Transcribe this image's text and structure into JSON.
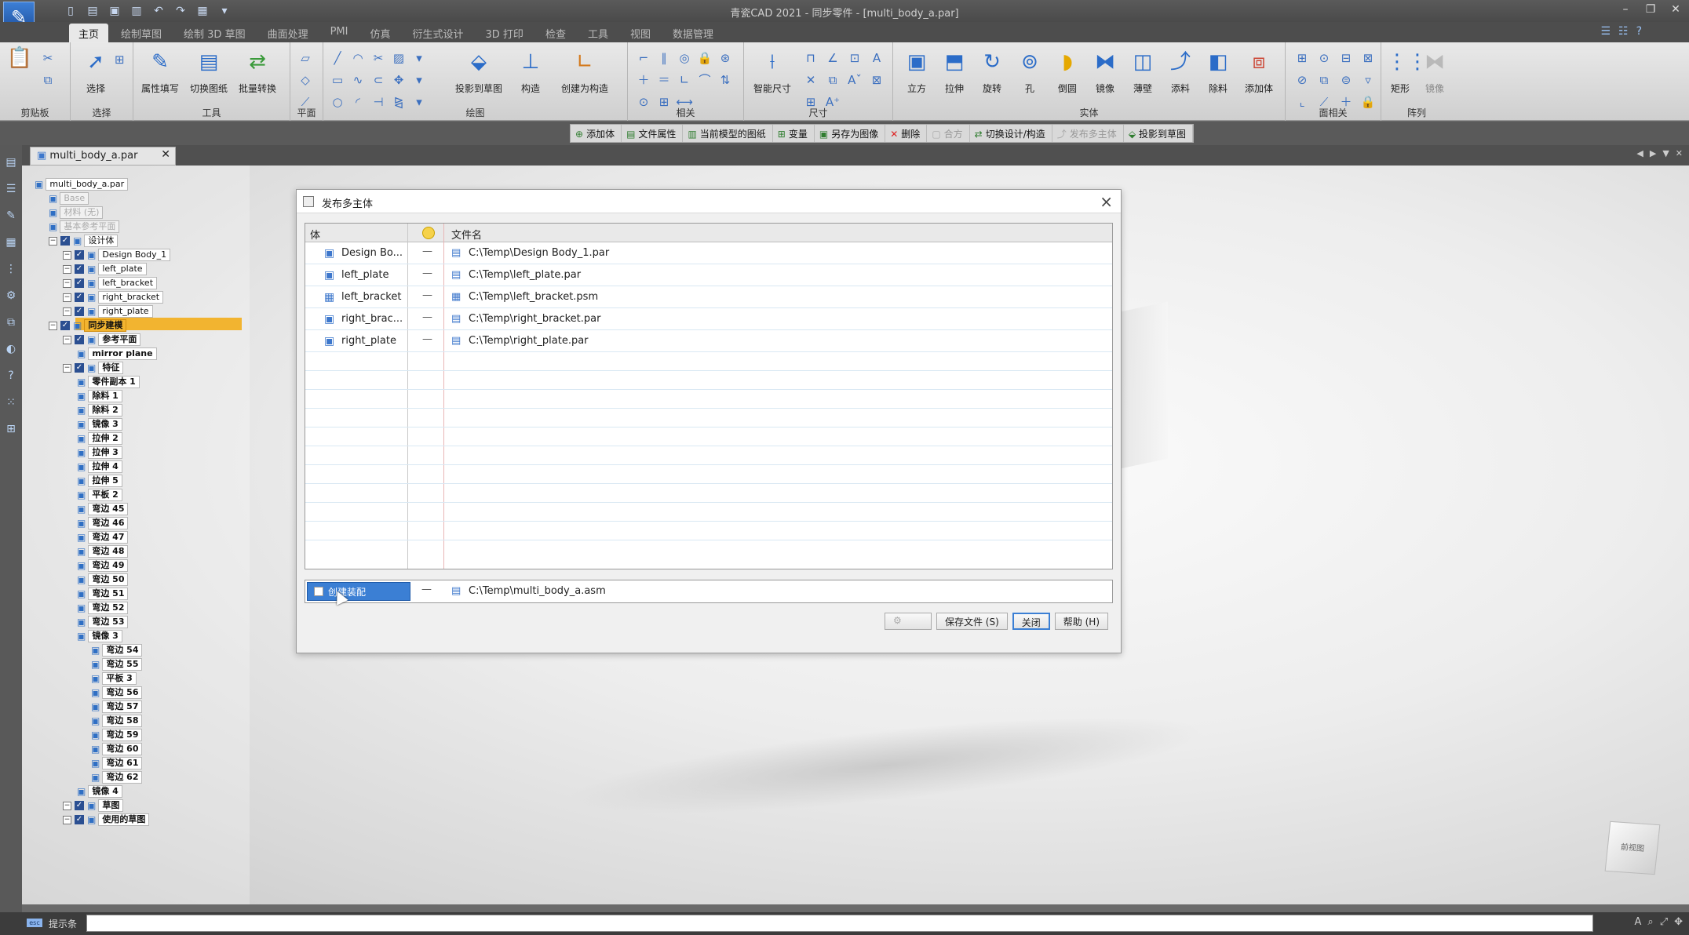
{
  "app": {
    "window_title": "青瓷CAD 2021 - 同步零件 - [multi_body_a.par]",
    "logo_icon": "pen-logo-icon"
  },
  "ribbon": {
    "tabs": [
      "主页",
      "绘制草图",
      "绘制 3D 草图",
      "曲面处理",
      "PMI",
      "仿真",
      "衍生式设计",
      "3D 打印",
      "检查",
      "工具",
      "视图",
      "数据管理"
    ],
    "groups": [
      {
        "label": "剪贴板"
      },
      {
        "label": "选择",
        "buttons": [
          "选择"
        ]
      },
      {
        "label": "工具",
        "buttons": [
          "属性填写",
          "切换图纸",
          "批量转换"
        ]
      },
      {
        "label": "平面"
      },
      {
        "label": "绘图",
        "buttons": [
          "投影到草图",
          "构造",
          "创建为构造"
        ]
      },
      {
        "label": "相关"
      },
      {
        "label": "尺寸",
        "buttons": [
          "智能尺寸"
        ]
      },
      {
        "label": "实体",
        "buttons": [
          "立方",
          "拉伸",
          "旋转",
          "孔",
          "倒圆",
          "镜像",
          "薄壁",
          "添料",
          "除料",
          "添加体"
        ]
      },
      {
        "label": "面相关"
      },
      {
        "label": "阵列",
        "buttons": [
          "矩形",
          "镜像"
        ]
      }
    ]
  },
  "command_bar": {
    "items": [
      "添加体",
      "文件属性",
      "当前模型的图纸",
      "变量",
      "另存为图像",
      "删除",
      "合方",
      "切换设计/构造",
      "发布多主体",
      "投影到草图"
    ]
  },
  "document": {
    "tab_label": "multi_body_a.par"
  },
  "pathfinder": {
    "items": [
      {
        "label": "multi_body_a.par",
        "level": 0
      },
      {
        "label": "Base",
        "level": 1,
        "grey": true
      },
      {
        "label": "材料 (无)",
        "level": 1,
        "grey": true
      },
      {
        "label": "基本参考平面",
        "level": 1,
        "grey": true
      },
      {
        "label": "设计体",
        "level": 1
      },
      {
        "label": "Design Body_1",
        "level": 2
      },
      {
        "label": "left_plate",
        "level": 2
      },
      {
        "label": "left_bracket",
        "level": 2
      },
      {
        "label": "right_bracket",
        "level": 2
      },
      {
        "label": "right_plate",
        "level": 2
      },
      {
        "label": "同步建模",
        "level": 1,
        "highlight": true
      },
      {
        "label": "参考平面",
        "level": 2,
        "bold": true
      },
      {
        "label": "mirror plane",
        "level": 3,
        "bold": true
      },
      {
        "label": "特征",
        "level": 2,
        "bold": true
      },
      {
        "label": "零件副本 1",
        "level": 3,
        "bold": true
      },
      {
        "label": "除料 1",
        "level": 3,
        "bold": true
      },
      {
        "label": "除料 2",
        "level": 3,
        "bold": true
      },
      {
        "label": "镜像 3",
        "level": 3,
        "bold": true
      },
      {
        "label": "拉伸 2",
        "level": 3,
        "bold": true
      },
      {
        "label": "拉伸 3",
        "level": 3,
        "bold": true
      },
      {
        "label": "拉伸 4",
        "level": 3,
        "bold": true
      },
      {
        "label": "拉伸 5",
        "level": 3,
        "bold": true
      },
      {
        "label": "平板 2",
        "level": 3,
        "bold": true
      },
      {
        "label": "弯边 45",
        "level": 3,
        "bold": true
      },
      {
        "label": "弯边 46",
        "level": 3,
        "bold": true
      },
      {
        "label": "弯边 47",
        "level": 3,
        "bold": true
      },
      {
        "label": "弯边 48",
        "level": 3,
        "bold": true
      },
      {
        "label": "弯边 49",
        "level": 3,
        "bold": true
      },
      {
        "label": "弯边 50",
        "level": 3,
        "bold": true
      },
      {
        "label": "弯边 51",
        "level": 3,
        "bold": true
      },
      {
        "label": "弯边 52",
        "level": 3,
        "bold": true
      },
      {
        "label": "弯边 53",
        "level": 3,
        "bold": true
      },
      {
        "label": "镜像 3",
        "level": 3,
        "bold": true
      },
      {
        "label": "弯边 54",
        "level": 4,
        "bold": true
      },
      {
        "label": "弯边 55",
        "level": 4,
        "bold": true
      },
      {
        "label": "平板 3",
        "level": 4,
        "bold": true
      },
      {
        "label": "弯边 56",
        "level": 4,
        "bold": true
      },
      {
        "label": "弯边 57",
        "level": 4,
        "bold": true
      },
      {
        "label": "弯边 58",
        "level": 4,
        "bold": true
      },
      {
        "label": "弯边 59",
        "level": 4,
        "bold": true
      },
      {
        "label": "弯边 60",
        "level": 4,
        "bold": true
      },
      {
        "label": "弯边 61",
        "level": 4,
        "bold": true
      },
      {
        "label": "弯边 62",
        "level": 4,
        "bold": true
      },
      {
        "label": "镜像 4",
        "level": 3,
        "bold": true
      },
      {
        "label": "草图",
        "level": 2,
        "bold": true
      },
      {
        "label": "使用的草图",
        "level": 2,
        "bold": true
      }
    ]
  },
  "dialog": {
    "title": "发布多主体",
    "columns": {
      "body": "体",
      "file": "文件名"
    },
    "rows": [
      {
        "name": "Design Bo...",
        "flag": "—",
        "path": "C:\\Temp\\Design Body_1.par"
      },
      {
        "name": "left_plate",
        "flag": "—",
        "path": "C:\\Temp\\left_plate.par"
      },
      {
        "name": "left_bracket",
        "flag": "—",
        "path": "C:\\Temp\\left_bracket.psm"
      },
      {
        "name": "right_brac...",
        "flag": "—",
        "path": "C:\\Temp\\right_bracket.par"
      },
      {
        "name": "right_plate",
        "flag": "—",
        "path": "C:\\Temp\\right_plate.par"
      }
    ],
    "assembly": {
      "label": "创建装配",
      "flag": "—",
      "path": "C:\\Temp\\multi_body_a.asm"
    },
    "buttons": {
      "save": "保存文件 (S)",
      "close": "关闭",
      "help": "帮助 (H)"
    }
  },
  "status": {
    "label": "提示条",
    "badge": "esc"
  },
  "viewcube": {
    "label": "前视图"
  },
  "colors": {
    "accent": "#3b7fd4",
    "highlight": "#f2b430"
  }
}
